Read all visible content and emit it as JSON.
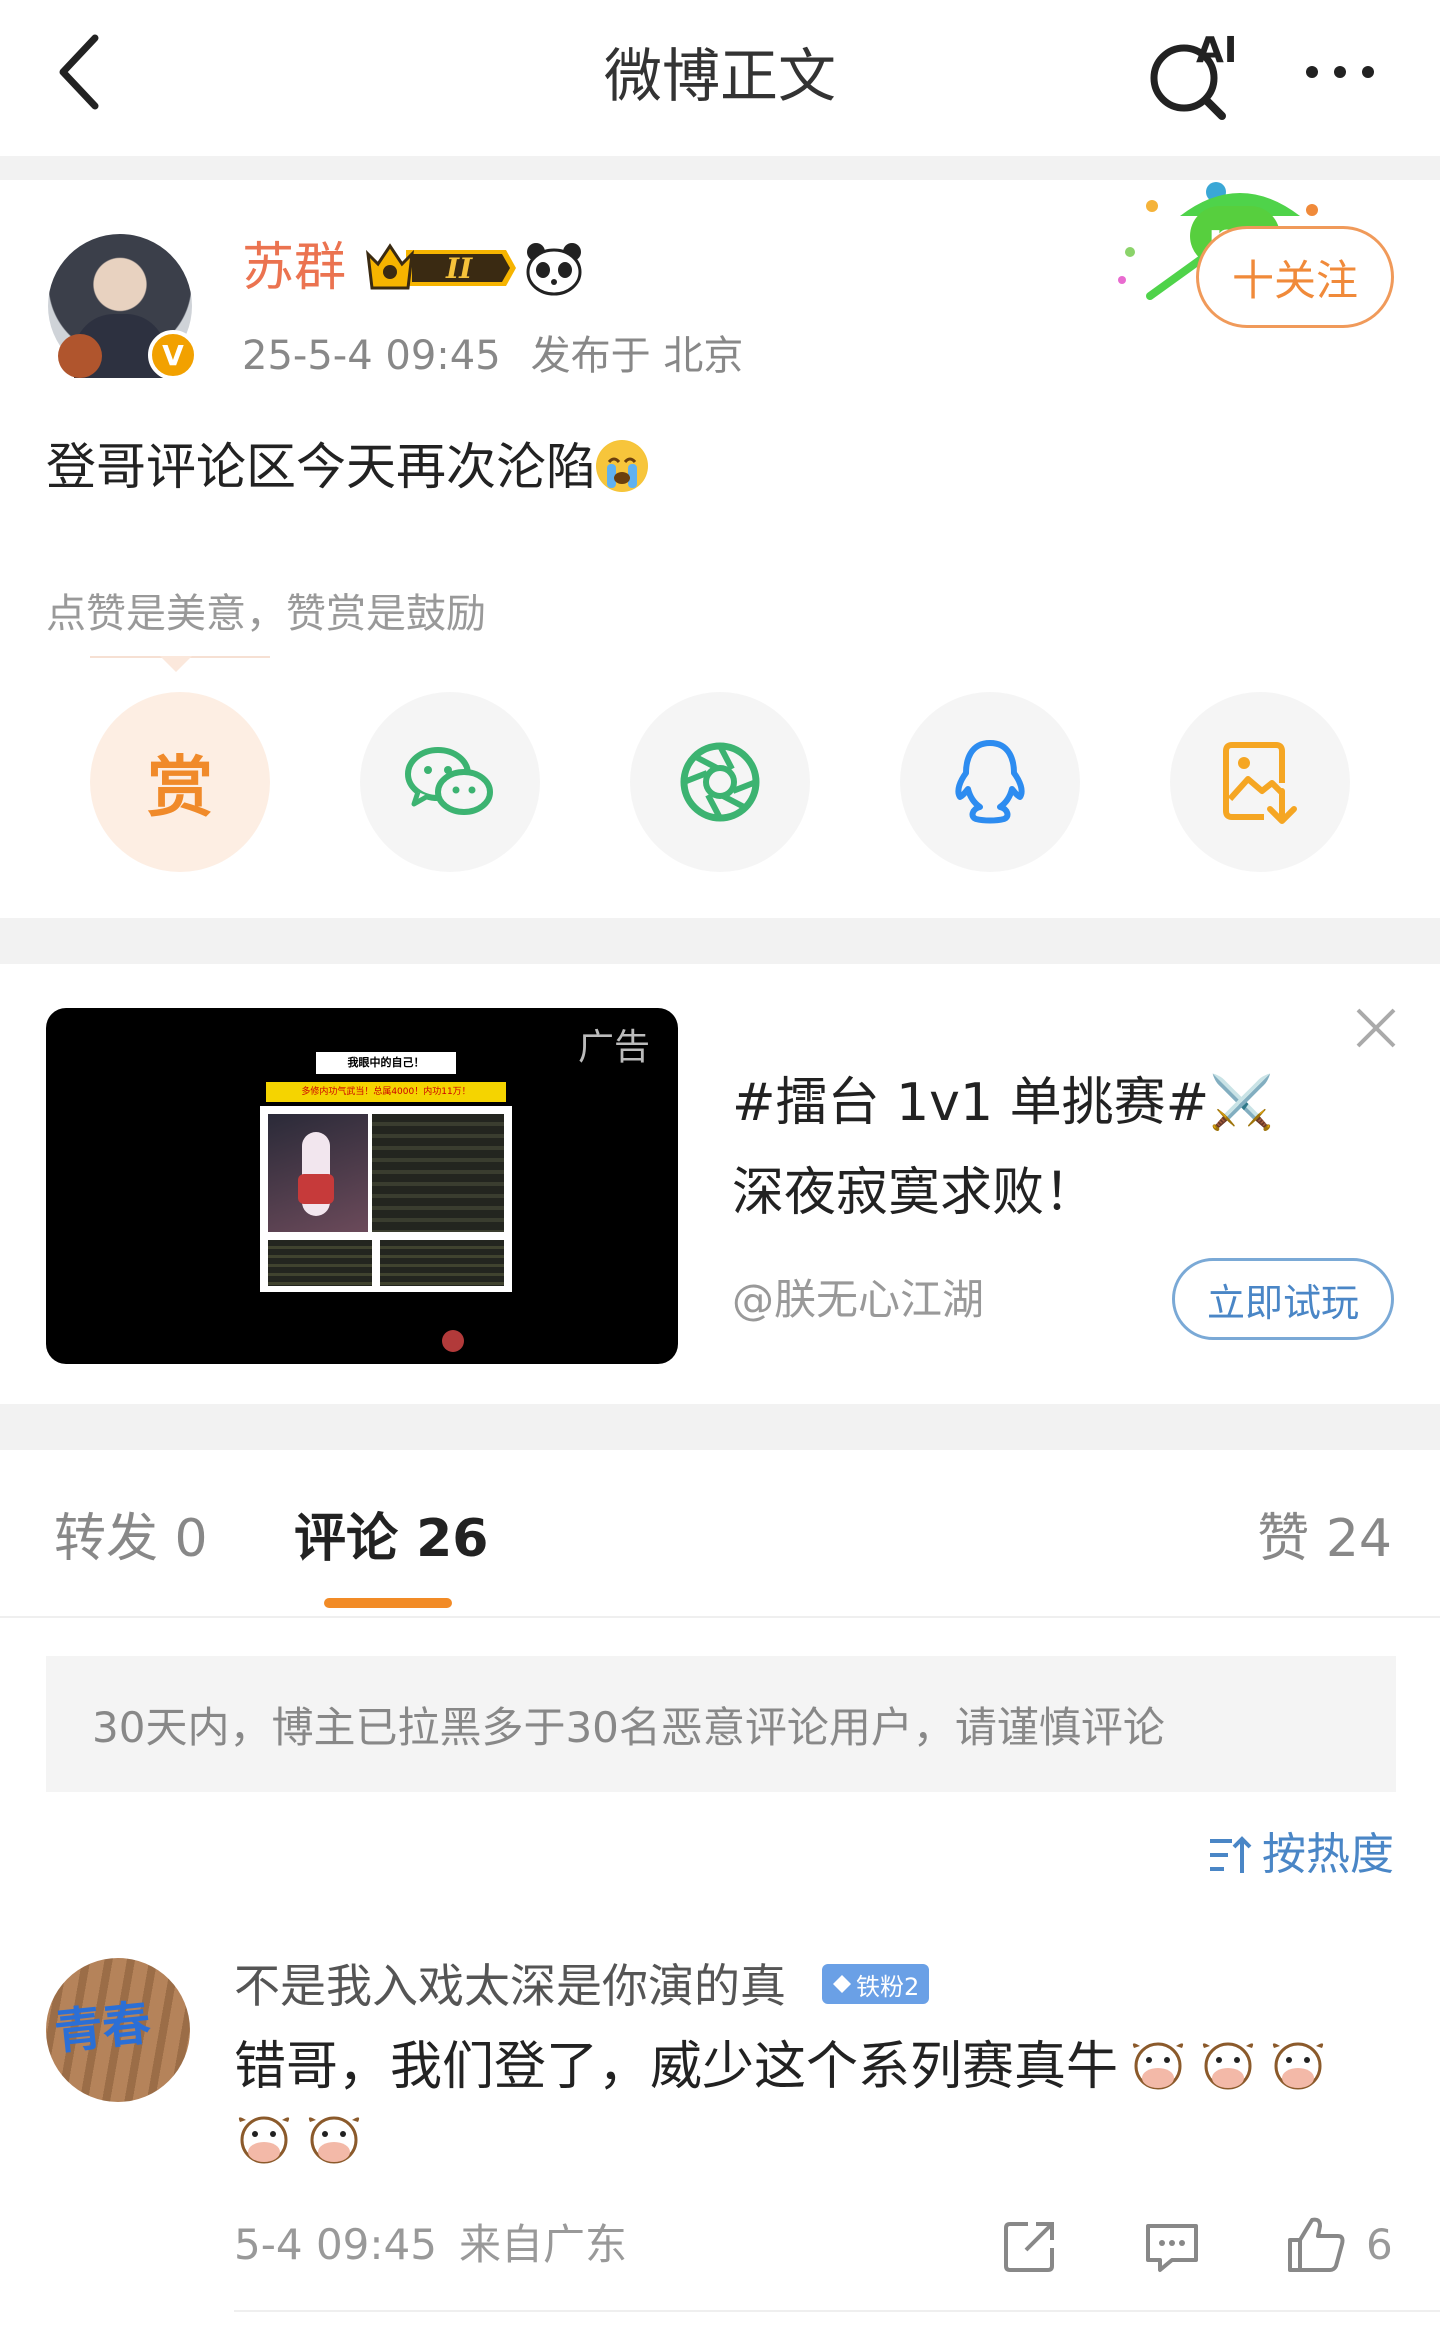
{
  "header": {
    "title": "微博正文",
    "ai_label": "AI"
  },
  "post": {
    "author": "苏群",
    "vip_level": "II",
    "verified_mark": "V",
    "time": "25-5-4 09:45",
    "location": "发布于 北京",
    "follow_label": "十关注",
    "text": "登哥评论区今天再次沦陷",
    "reward_hint": "点赞是美意，赞赏是鼓励",
    "reward_icon_label": "赏"
  },
  "ad": {
    "label": "广告",
    "title": "#擂台 1v1 单挑赛#⚔️",
    "subtitle": "深夜寂寞求败！",
    "account": "@朕无心江湖",
    "cta": "立即试玩",
    "image_caption": "我眼中的自己！",
    "image_subcaption": "多修内功气武当！总属4000！内功11万！"
  },
  "tabs": {
    "repost": "转发 0",
    "comment": "评论 26",
    "like": "赞 24"
  },
  "notice": "30天内，博主已拉黑多于30名恶意评论用户，请谨慎评论",
  "sort_label": "按热度",
  "comment": {
    "user": "不是我入戏太深是你演的真",
    "badge": "铁粉2",
    "avatar_text": "青春",
    "text": "错哥，我们登了，威少这个系列赛真牛",
    "time": "5-4 09:45",
    "location": "来自广东",
    "like_count": "6"
  },
  "colors": {
    "orange": "#eb7350",
    "blue": "#4a86c6",
    "tab_indicator": "#f28b26"
  }
}
